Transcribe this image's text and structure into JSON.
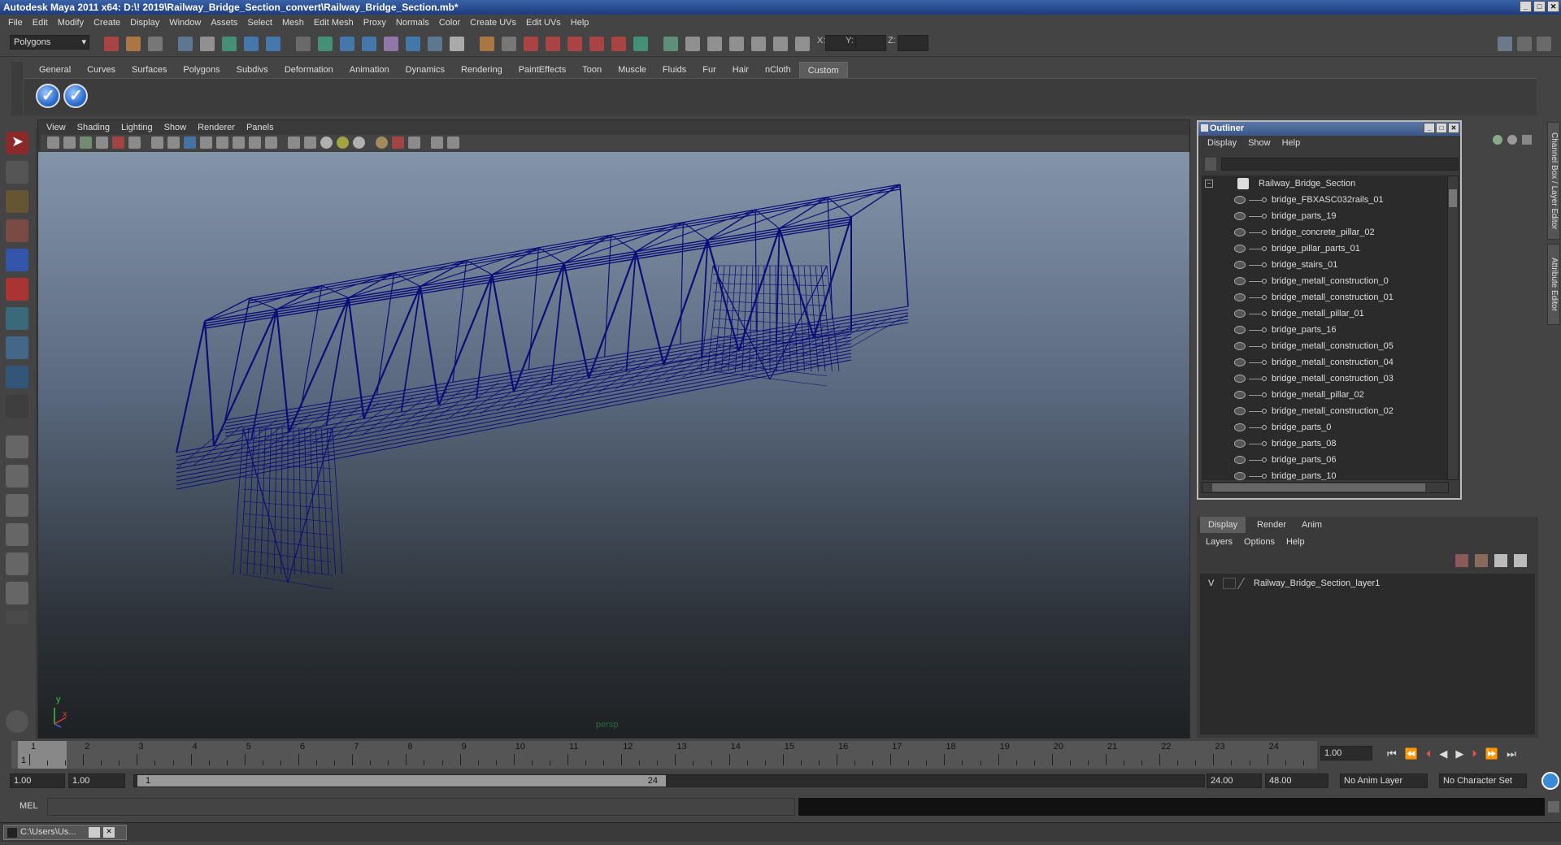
{
  "window": {
    "title": "Autodesk Maya 2011 x64: D:\\! 2019\\Railway_Bridge_Section_convert\\Railway_Bridge_Section.mb*"
  },
  "menubar": [
    "File",
    "Edit",
    "Modify",
    "Create",
    "Display",
    "Window",
    "Assets",
    "Select",
    "Mesh",
    "Edit Mesh",
    "Proxy",
    "Normals",
    "Color",
    "Create UVs",
    "Edit UVs",
    "Help"
  ],
  "statusline": {
    "mode": "Polygons",
    "x_label": "X:",
    "y_label": "Y:",
    "z_label": "Z:"
  },
  "shelf": {
    "tabs": [
      "General",
      "Curves",
      "Surfaces",
      "Polygons",
      "Subdivs",
      "Deformation",
      "Animation",
      "Dynamics",
      "Rendering",
      "PaintEffects",
      "Toon",
      "Muscle",
      "Fluids",
      "Fur",
      "Hair",
      "nCloth",
      "Custom"
    ],
    "active_tab": "Custom"
  },
  "viewport": {
    "menu": [
      "View",
      "Shading",
      "Lighting",
      "Show",
      "Renderer",
      "Panels"
    ],
    "camera_label": "persp",
    "axis_x": "x",
    "axis_y": "y",
    "wire_color": "#0b0d78"
  },
  "outliner": {
    "title": "Outliner",
    "menu": [
      "Display",
      "Show",
      "Help"
    ],
    "root": "Railway_Bridge_Section",
    "items": [
      "bridge_FBXASC032rails_01",
      "bridge_parts_19",
      "bridge_concrete_pillar_02",
      "bridge_pillar_parts_01",
      "bridge_stairs_01",
      "bridge_metall_construction_0",
      "bridge_metall_construction_01",
      "bridge_metall_pillar_01",
      "bridge_parts_16",
      "bridge_metall_construction_05",
      "bridge_metall_construction_04",
      "bridge_metall_construction_03",
      "bridge_metall_pillar_02",
      "bridge_metall_construction_02",
      "bridge_parts_0",
      "bridge_parts_08",
      "bridge_parts_06",
      "bridge_parts_10"
    ]
  },
  "side_tabs": {
    "channel_box": "Channel Box / Layer Editor",
    "attribute_editor": "Attribute Editor"
  },
  "layer_editor": {
    "tabs": [
      "Display",
      "Render",
      "Anim"
    ],
    "active_tab": "Display",
    "menu": [
      "Layers",
      "Options",
      "Help"
    ],
    "layer_visibility": "V",
    "layer_name": "Railway_Bridge_Section_layer1"
  },
  "timeline": {
    "ticks": [
      "1",
      "2",
      "3",
      "4",
      "5",
      "6",
      "7",
      "8",
      "9",
      "10",
      "11",
      "12",
      "13",
      "14",
      "15",
      "16",
      "17",
      "18",
      "19",
      "20",
      "21",
      "22",
      "23",
      "24"
    ],
    "current_frame": "1.00",
    "current_marker": "1"
  },
  "range": {
    "start_time": "1.00",
    "playback_start": "1.00",
    "range_start": "1",
    "range_end": "24",
    "playback_end": "24.00",
    "end_time": "48.00",
    "anim_layer": "No Anim Layer",
    "character_set": "No Character Set"
  },
  "command_line": {
    "label": "MEL"
  },
  "taskbar": {
    "item": "C:\\Users\\Us..."
  }
}
